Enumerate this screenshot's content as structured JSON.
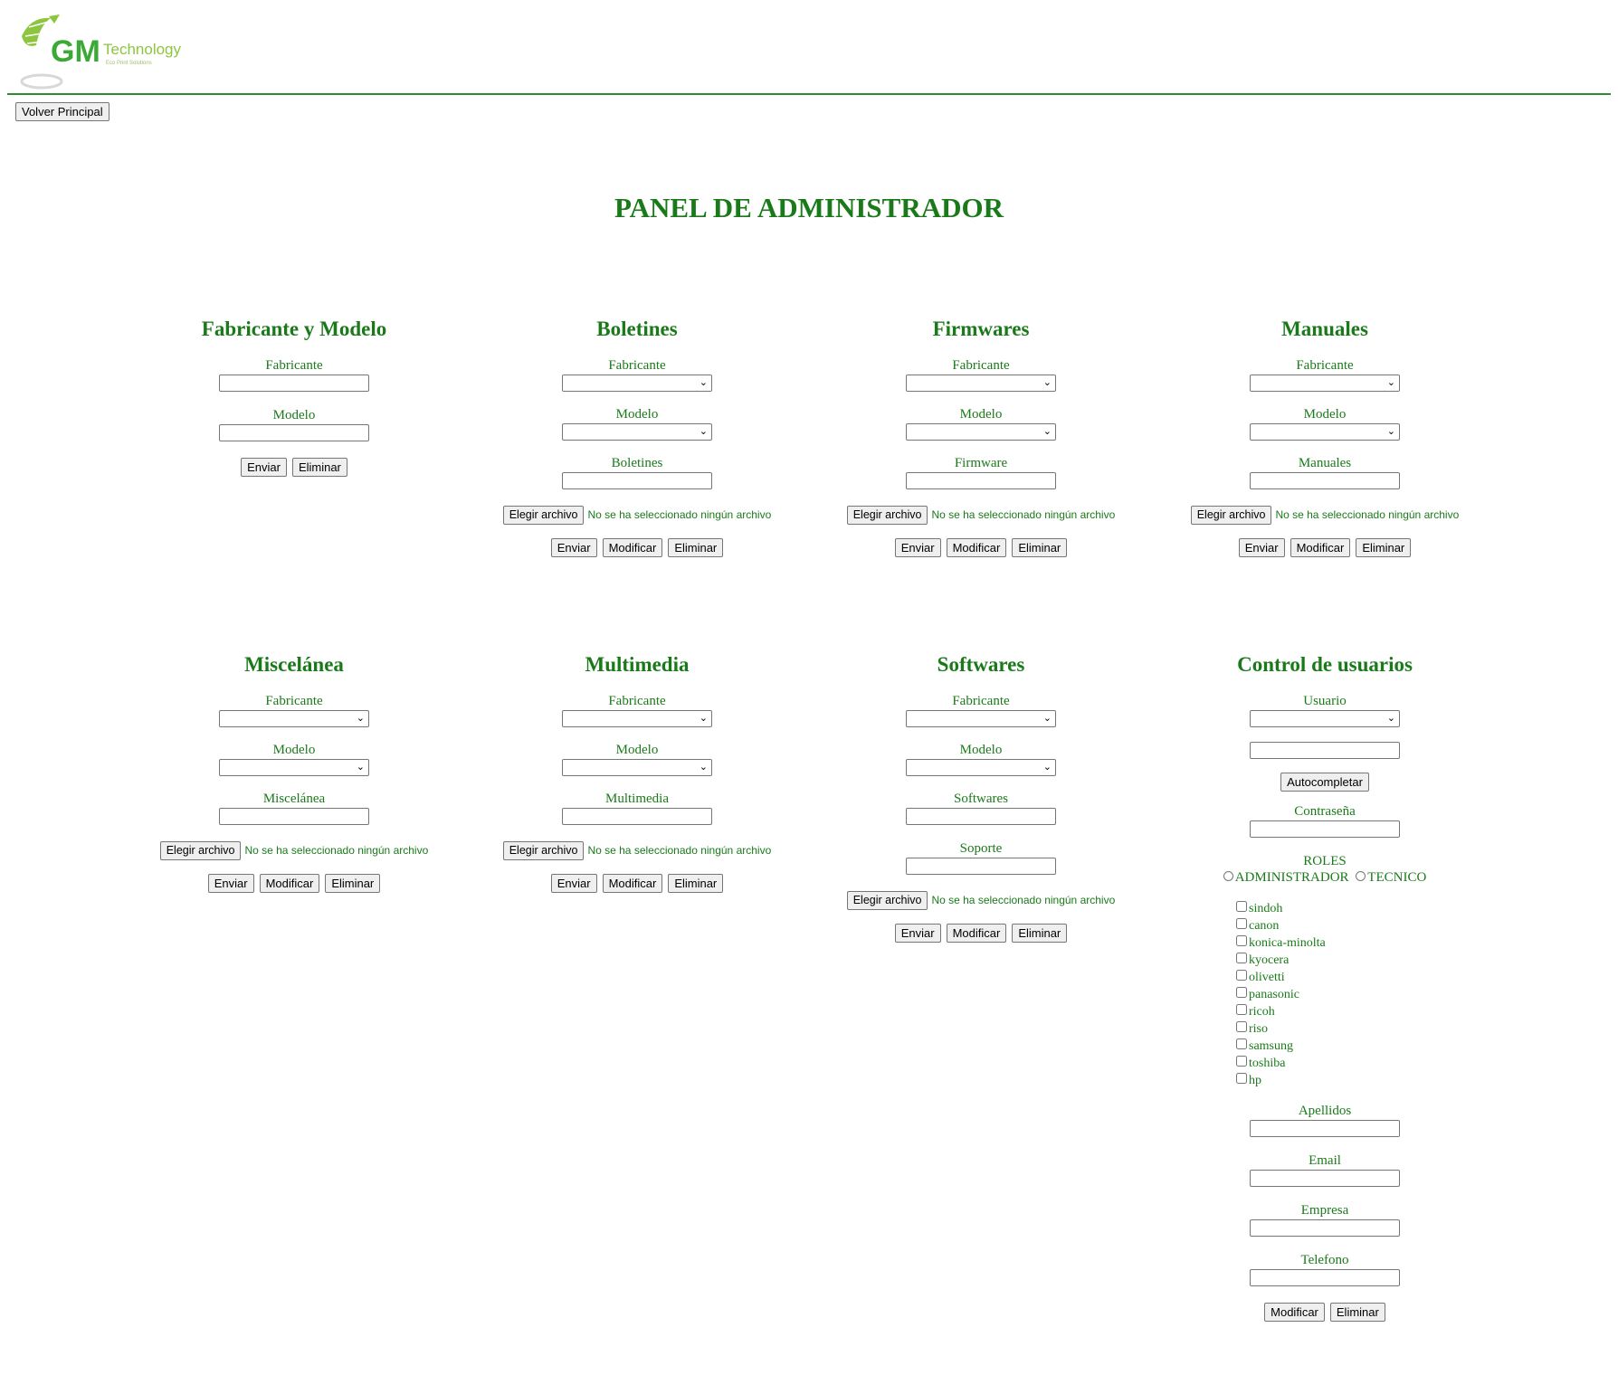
{
  "logo": {
    "brand": "GM",
    "name": "Technology",
    "tagline": "Eco Print Solutions"
  },
  "nav": {
    "back_label": "Volver Principal"
  },
  "page_title": "PANEL DE ADMINISTRADOR",
  "file_choose_label": "Elegir archivo",
  "file_none_label": "No se ha seleccionado ningún archivo",
  "buttons": {
    "send": "Enviar",
    "modify": "Modificar",
    "delete": "Eliminar",
    "autocomplete": "Autocompletar"
  },
  "panels": {
    "fabricante_modelo": {
      "title": "Fabricante y Modelo",
      "fabricante": "Fabricante",
      "modelo": "Modelo"
    },
    "boletines": {
      "title": "Boletines",
      "fabricante": "Fabricante",
      "modelo": "Modelo",
      "item": "Boletines"
    },
    "firmwares": {
      "title": "Firmwares",
      "fabricante": "Fabricante",
      "modelo": "Modelo",
      "item": "Firmware"
    },
    "manuales": {
      "title": "Manuales",
      "fabricante": "Fabricante",
      "modelo": "Modelo",
      "item": "Manuales"
    },
    "miscelanea": {
      "title": "Miscelánea",
      "fabricante": "Fabricante",
      "modelo": "Modelo",
      "item": "Miscelánea"
    },
    "multimedia": {
      "title": "Multimedia",
      "fabricante": "Fabricante",
      "modelo": "Modelo",
      "item": "Multimedia"
    },
    "softwares": {
      "title": "Softwares",
      "fabricante": "Fabricante",
      "modelo": "Modelo",
      "item": "Softwares",
      "support": "Soporte"
    },
    "usuarios": {
      "title": "Control de usuarios",
      "usuario": "Usuario",
      "password": "Contraseña",
      "roles_label": "ROLES",
      "roles": [
        "ADMINISTRADOR",
        "TECNICO"
      ],
      "brands": [
        "sindoh",
        "canon",
        "konica-minolta",
        "kyocera",
        "olivetti",
        "panasonic",
        "ricoh",
        "riso",
        "samsung",
        "toshiba",
        "hp"
      ],
      "apellidos": "Apellidos",
      "email": "Email",
      "empresa": "Empresa",
      "telefono": "Telefono"
    }
  },
  "colors": {
    "accent": "#1a7a1a",
    "rule": "#2e8b2e"
  }
}
